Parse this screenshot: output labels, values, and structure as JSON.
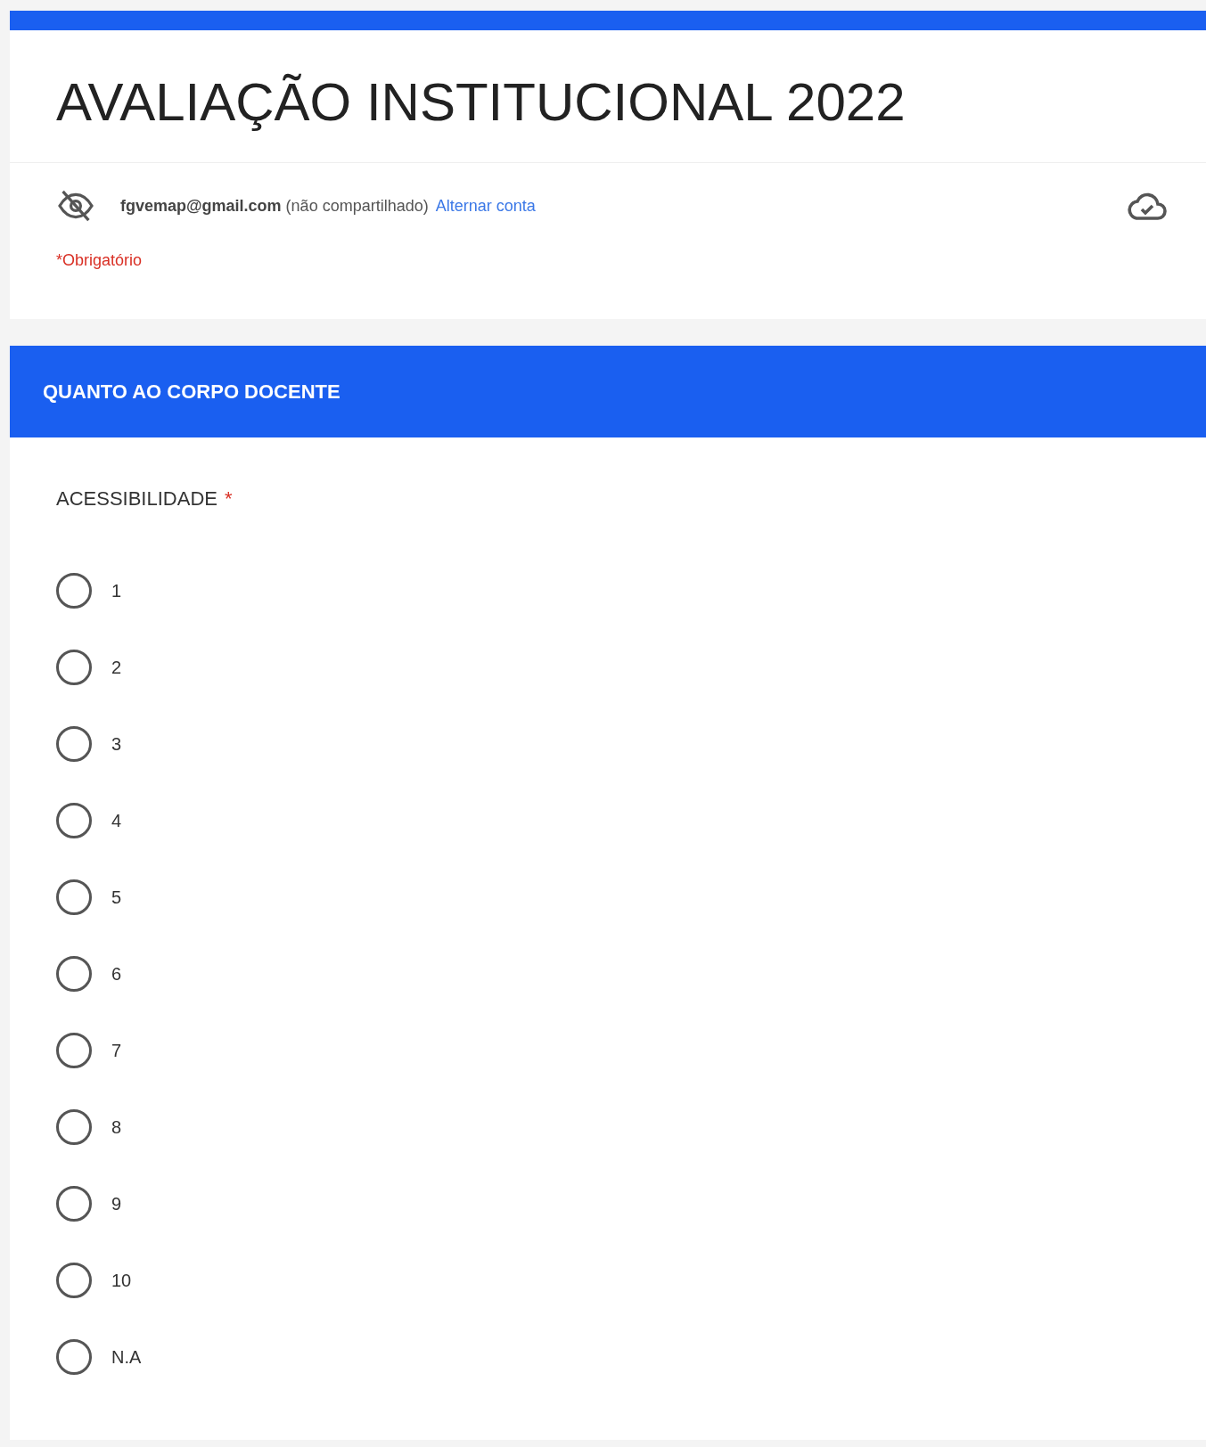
{
  "form": {
    "title": "AVALIAÇÃO INSTITUCIONAL 2022"
  },
  "account": {
    "email": "fgvemap@gmail.com",
    "note": "(não compartilhado)",
    "switch_link": "Alternar conta"
  },
  "required_note": "*Obrigatório",
  "section": {
    "title": "QUANTO AO CORPO DOCENTE"
  },
  "question": {
    "label": "ACESSIBILIDADE",
    "required_mark": "*",
    "options": [
      {
        "label": "1",
        "selected": false
      },
      {
        "label": "2",
        "selected": false
      },
      {
        "label": "3",
        "selected": false
      },
      {
        "label": "4",
        "selected": false
      },
      {
        "label": "5",
        "selected": false
      },
      {
        "label": "6",
        "selected": false
      },
      {
        "label": "7",
        "selected": false
      },
      {
        "label": "8",
        "selected": false
      },
      {
        "label": "9",
        "selected": false
      },
      {
        "label": "10",
        "selected": false
      },
      {
        "label": "N.A",
        "selected": false
      }
    ]
  }
}
